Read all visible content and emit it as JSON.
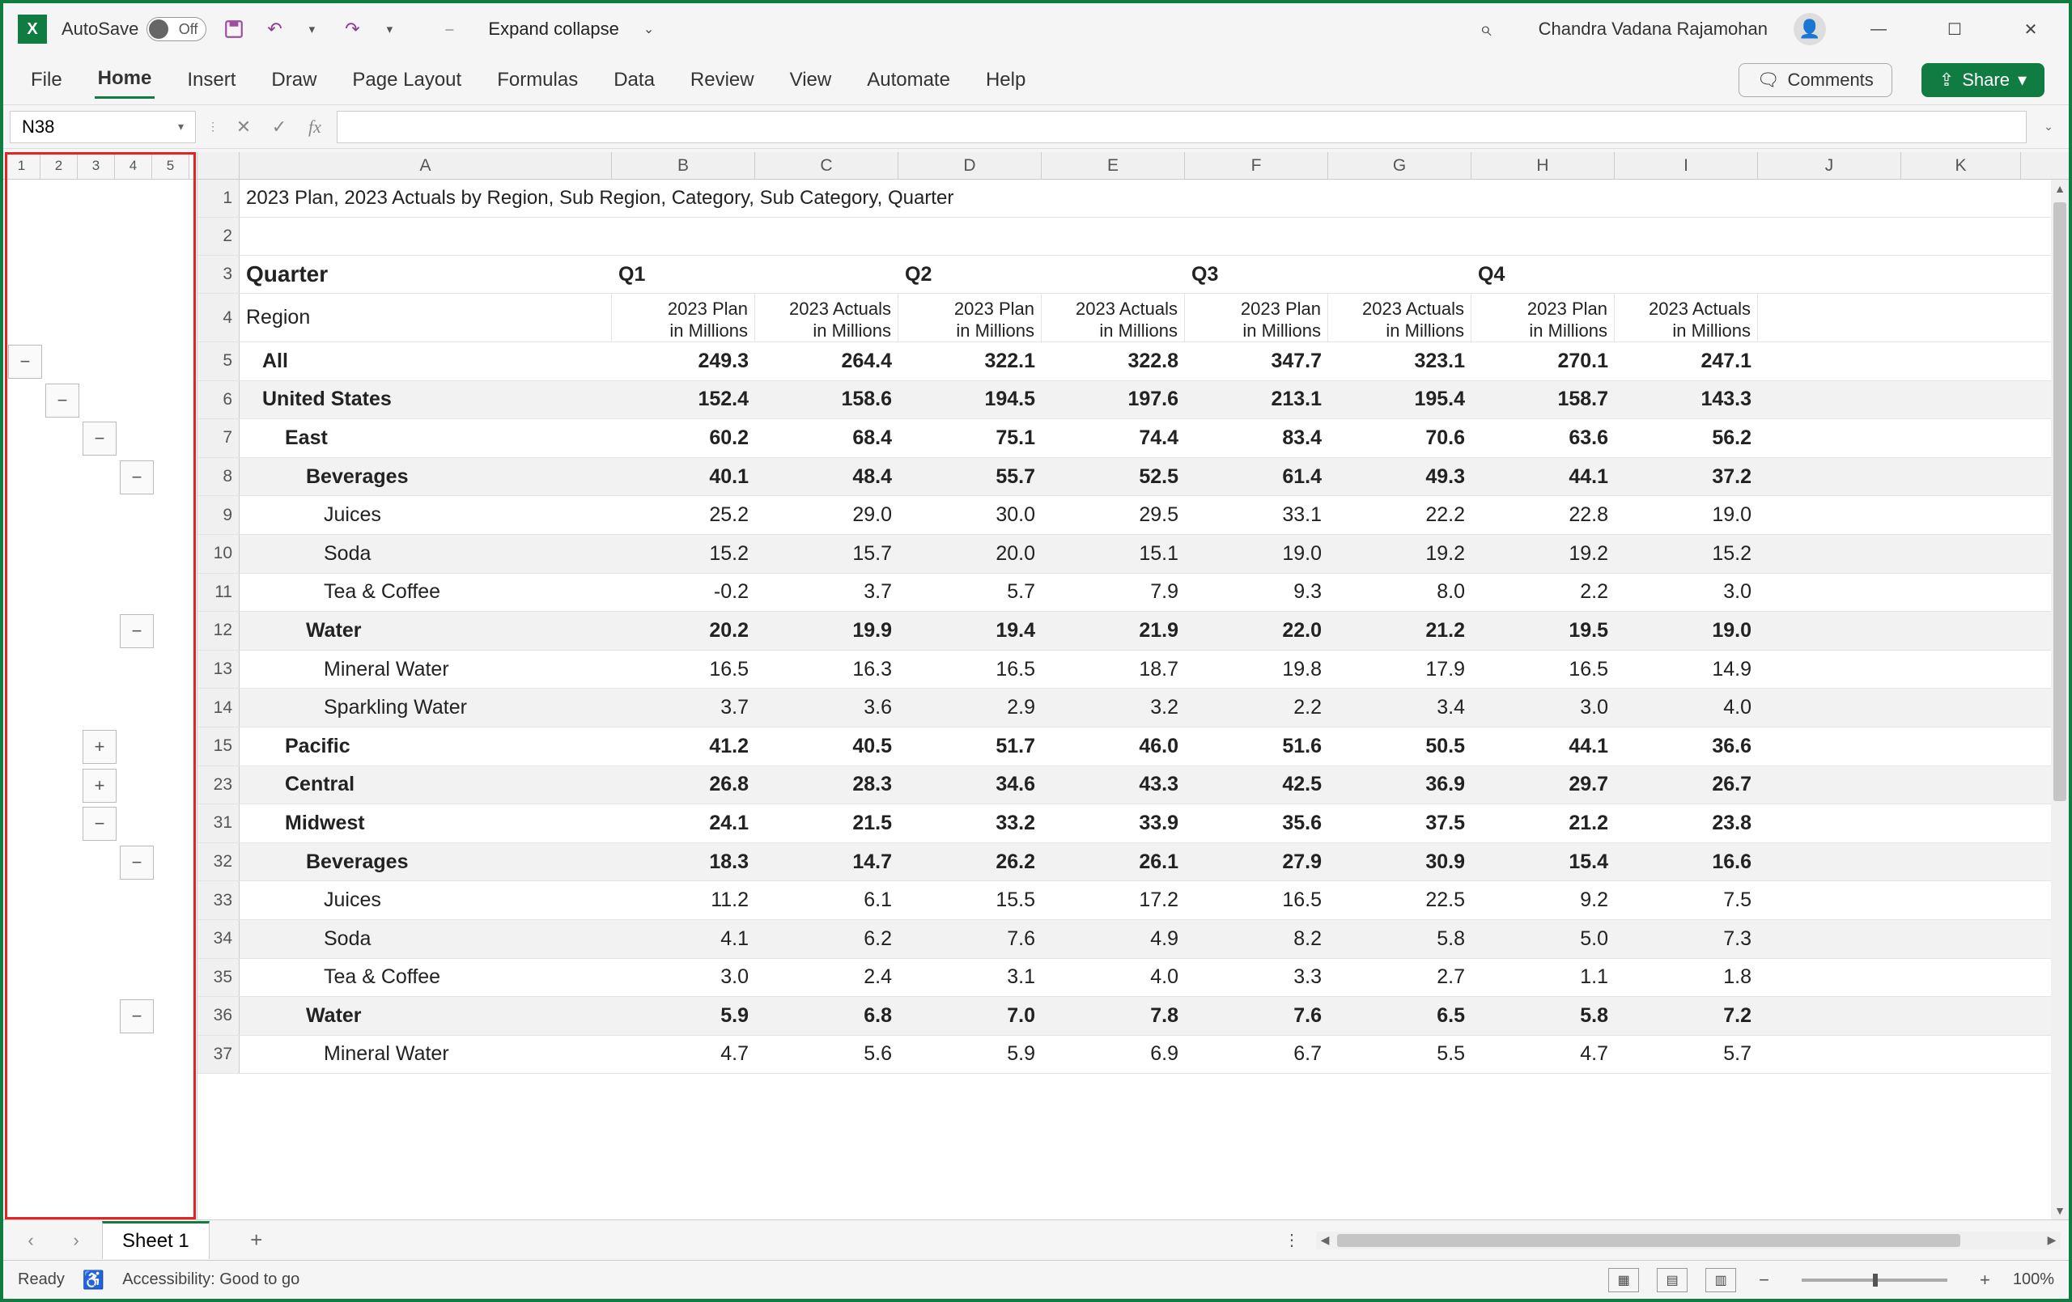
{
  "titlebar": {
    "autosave_label": "AutoSave",
    "autosave_state": "Off",
    "doc_title": "Expand collapse",
    "user_name": "Chandra Vadana Rajamohan"
  },
  "ribbon": {
    "tabs": [
      "File",
      "Home",
      "Insert",
      "Draw",
      "Page Layout",
      "Formulas",
      "Data",
      "Review",
      "View",
      "Automate",
      "Help"
    ],
    "comments_label": "Comments",
    "share_label": "Share"
  },
  "namebox": {
    "value": "N38"
  },
  "outline_levels": [
    "1",
    "2",
    "3",
    "4",
    "5"
  ],
  "columns": [
    "A",
    "B",
    "C",
    "D",
    "E",
    "F",
    "G",
    "H",
    "I",
    "J",
    "K"
  ],
  "title_row": "2023 Plan, 2023 Actuals by Region, Sub Region, Category, Sub Category, Quarter",
  "q_header": {
    "label": "Quarter",
    "q1": "Q1",
    "q2": "Q2",
    "q3": "Q3",
    "q4": "Q4"
  },
  "region_row": {
    "label": "Region",
    "sub": [
      "2023 Plan in Millions",
      "2023 Actuals in Millions",
      "2023 Plan in Millions",
      "2023 Actuals in Millions",
      "2023 Plan in Millions",
      "2023 Actuals in Millions",
      "2023 Plan in Millions",
      "2023 Actuals in Millions"
    ]
  },
  "rows": [
    {
      "rn": "5",
      "indent": 1,
      "bold": true,
      "label": "All",
      "v": [
        "249.3",
        "264.4",
        "322.1",
        "322.8",
        "347.7",
        "323.1",
        "270.1",
        "247.1"
      ]
    },
    {
      "rn": "6",
      "indent": 1,
      "bold": true,
      "label": "United States",
      "v": [
        "152.4",
        "158.6",
        "194.5",
        "197.6",
        "213.1",
        "195.4",
        "158.7",
        "143.3"
      ],
      "stripe": true
    },
    {
      "rn": "7",
      "indent": 2,
      "bold": true,
      "label": "East",
      "v": [
        "60.2",
        "68.4",
        "75.1",
        "74.4",
        "83.4",
        "70.6",
        "63.6",
        "56.2"
      ]
    },
    {
      "rn": "8",
      "indent": 3,
      "bold": true,
      "label": "Beverages",
      "v": [
        "40.1",
        "48.4",
        "55.7",
        "52.5",
        "61.4",
        "49.3",
        "44.1",
        "37.2"
      ],
      "stripe": true
    },
    {
      "rn": "9",
      "indent": 4,
      "bold": false,
      "label": "Juices",
      "v": [
        "25.2",
        "29.0",
        "30.0",
        "29.5",
        "33.1",
        "22.2",
        "22.8",
        "19.0"
      ]
    },
    {
      "rn": "10",
      "indent": 4,
      "bold": false,
      "label": "Soda",
      "v": [
        "15.2",
        "15.7",
        "20.0",
        "15.1",
        "19.0",
        "19.2",
        "19.2",
        "15.2"
      ],
      "stripe": true
    },
    {
      "rn": "11",
      "indent": 4,
      "bold": false,
      "label": "Tea & Coffee",
      "v": [
        "-0.2",
        "3.7",
        "5.7",
        "7.9",
        "9.3",
        "8.0",
        "2.2",
        "3.0"
      ]
    },
    {
      "rn": "12",
      "indent": 3,
      "bold": true,
      "label": "Water",
      "v": [
        "20.2",
        "19.9",
        "19.4",
        "21.9",
        "22.0",
        "21.2",
        "19.5",
        "19.0"
      ],
      "stripe": true
    },
    {
      "rn": "13",
      "indent": 4,
      "bold": false,
      "label": "Mineral Water",
      "v": [
        "16.5",
        "16.3",
        "16.5",
        "18.7",
        "19.8",
        "17.9",
        "16.5",
        "14.9"
      ]
    },
    {
      "rn": "14",
      "indent": 4,
      "bold": false,
      "label": "Sparkling Water",
      "v": [
        "3.7",
        "3.6",
        "2.9",
        "3.2",
        "2.2",
        "3.4",
        "3.0",
        "4.0"
      ],
      "stripe": true
    },
    {
      "rn": "15",
      "indent": 2,
      "bold": true,
      "label": "Pacific",
      "v": [
        "41.2",
        "40.5",
        "51.7",
        "46.0",
        "51.6",
        "50.5",
        "44.1",
        "36.6"
      ]
    },
    {
      "rn": "23",
      "indent": 2,
      "bold": true,
      "label": "Central",
      "v": [
        "26.8",
        "28.3",
        "34.6",
        "43.3",
        "42.5",
        "36.9",
        "29.7",
        "26.7"
      ],
      "stripe": true
    },
    {
      "rn": "31",
      "indent": 2,
      "bold": true,
      "label": "Midwest",
      "v": [
        "24.1",
        "21.5",
        "33.2",
        "33.9",
        "35.6",
        "37.5",
        "21.2",
        "23.8"
      ]
    },
    {
      "rn": "32",
      "indent": 3,
      "bold": true,
      "label": "Beverages",
      "v": [
        "18.3",
        "14.7",
        "26.2",
        "26.1",
        "27.9",
        "30.9",
        "15.4",
        "16.6"
      ],
      "stripe": true
    },
    {
      "rn": "33",
      "indent": 4,
      "bold": false,
      "label": "Juices",
      "v": [
        "11.2",
        "6.1",
        "15.5",
        "17.2",
        "16.5",
        "22.5",
        "9.2",
        "7.5"
      ]
    },
    {
      "rn": "34",
      "indent": 4,
      "bold": false,
      "label": "Soda",
      "v": [
        "4.1",
        "6.2",
        "7.6",
        "4.9",
        "8.2",
        "5.8",
        "5.0",
        "7.3"
      ],
      "stripe": true
    },
    {
      "rn": "35",
      "indent": 4,
      "bold": false,
      "label": "Tea & Coffee",
      "v": [
        "3.0",
        "2.4",
        "3.1",
        "4.0",
        "3.3",
        "2.7",
        "1.1",
        "1.8"
      ]
    },
    {
      "rn": "36",
      "indent": 3,
      "bold": true,
      "label": "Water",
      "v": [
        "5.9",
        "6.8",
        "7.0",
        "7.8",
        "7.6",
        "6.5",
        "5.8",
        "7.2"
      ],
      "stripe": true
    },
    {
      "rn": "37",
      "indent": 4,
      "bold": false,
      "label": "Mineral Water",
      "v": [
        "4.7",
        "5.6",
        "5.9",
        "6.9",
        "6.7",
        "5.5",
        "4.7",
        "5.7"
      ]
    }
  ],
  "outline_buttons": [
    {
      "row": 1,
      "col": 0,
      "sym": "−"
    },
    {
      "row": 2,
      "col": 1,
      "sym": "−"
    },
    {
      "row": 3,
      "col": 2,
      "sym": "−"
    },
    {
      "row": 4,
      "col": 3,
      "sym": "−"
    },
    {
      "row": 8,
      "col": 3,
      "sym": "−"
    },
    {
      "row": 11,
      "col": 2,
      "sym": "+"
    },
    {
      "row": 12,
      "col": 2,
      "sym": "+"
    },
    {
      "row": 13,
      "col": 2,
      "sym": "−"
    },
    {
      "row": 14,
      "col": 3,
      "sym": "−"
    },
    {
      "row": 18,
      "col": 3,
      "sym": "−"
    }
  ],
  "sheet_tab": "Sheet 1",
  "status": {
    "ready": "Ready",
    "acc": "Accessibility: Good to go",
    "zoom": "100%"
  }
}
